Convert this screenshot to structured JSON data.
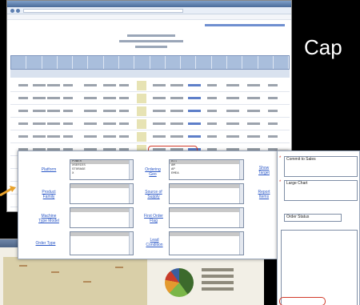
{
  "caption": "Cap",
  "browser": {
    "page_title": "",
    "page_subtitle": "",
    "grid": {
      "columns": [
        "",
        "",
        "",
        "",
        "",
        "",
        "",
        "",
        "",
        "",
        "",
        "",
        "",
        "",
        "",
        "",
        "",
        ""
      ],
      "rows": [
        [
          ""
        ],
        [
          ""
        ],
        [
          ""
        ],
        [
          ""
        ],
        [
          ""
        ],
        [
          ""
        ],
        [
          ""
        ],
        [
          ""
        ],
        [
          ""
        ],
        [
          ""
        ]
      ]
    }
  },
  "filters": {
    "platform": {
      "label": "Platform",
      "options": [
        "POWER",
        "XSERIES",
        "STORAGE",
        "X"
      ]
    },
    "product_family": {
      "label": "Product Family",
      "options": [
        "",
        "",
        "",
        ""
      ]
    },
    "machine_type_model": {
      "label": "Machine Type Model",
      "options": [
        "",
        "",
        "",
        ""
      ]
    },
    "order_type": {
      "label": "Order Type",
      "options": [
        "",
        "",
        "",
        ""
      ]
    },
    "ordering_geo": {
      "label": "Ordering Geo",
      "options": [
        "All",
        "AM",
        "AP",
        "EMEA"
      ]
    },
    "source_of_supply": {
      "label": "Source of Supply",
      "options": [
        "",
        "",
        "",
        ""
      ]
    },
    "first_order_flag": {
      "label": "First Order Flag",
      "options": [
        "",
        "",
        "",
        ""
      ]
    },
    "lead_condition": {
      "label": "Lead Condition",
      "options": [
        "",
        "",
        "",
        ""
      ]
    },
    "show_target": {
      "label": "Show Target"
    },
    "report_items": {
      "label": "Report Items"
    },
    "link3": {
      "label": ""
    },
    "link4": {
      "label": ""
    }
  },
  "options_panel": {
    "report_items": [
      "Commit to Sales",
      "",
      "",
      ""
    ],
    "chart_items": [
      "Large Chart",
      "",
      "",
      ""
    ],
    "link1": "",
    "order_status": "Order Status",
    "group_list": [
      "",
      "",
      "",
      "",
      "",
      "",
      "",
      "",
      "",
      "",
      "",
      "",
      "",
      ""
    ]
  }
}
